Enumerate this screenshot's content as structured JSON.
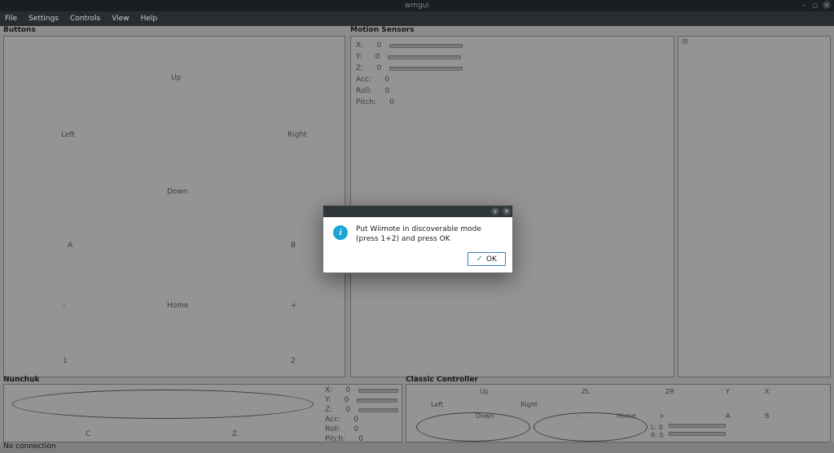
{
  "window": {
    "title": "wmgui",
    "controls": {
      "min": "–",
      "max": "○",
      "close": "✕"
    }
  },
  "menu": {
    "items": [
      "File",
      "Settings",
      "Controls",
      "View",
      "Help"
    ]
  },
  "sections": {
    "buttons": "Buttons",
    "motion": "Motion Sensors",
    "nunchuk": "Nunchuk",
    "classic": "Classic Controller",
    "ir": "IR"
  },
  "dpad": {
    "up": "Up",
    "down": "Down",
    "left": "Left",
    "right": "Right",
    "a": "A",
    "b": "B",
    "minus": "-",
    "home": "Home",
    "plus": "+",
    "one": "1",
    "two": "2"
  },
  "motion": {
    "rows": [
      {
        "label": "X:",
        "value": "0"
      },
      {
        "label": "Y:",
        "value": "0"
      },
      {
        "label": "Z:",
        "value": "0"
      },
      {
        "label": "Acc:",
        "value": "0"
      },
      {
        "label": "Roll:",
        "value": "0"
      },
      {
        "label": "Pitch:",
        "value": "0"
      }
    ]
  },
  "nunchuk": {
    "c": "C",
    "z": "Z",
    "rows": [
      {
        "label": "X:",
        "value": "0"
      },
      {
        "label": "Y:",
        "value": "0"
      },
      {
        "label": "Z:",
        "value": "0"
      },
      {
        "label": "Acc:",
        "value": "0"
      },
      {
        "label": "Roll:",
        "value": "0"
      },
      {
        "label": "Pitch:",
        "value": "0"
      }
    ]
  },
  "classic": {
    "labels": {
      "up": "Up",
      "down": "Down",
      "left": "Left",
      "right": "Right",
      "minus": "-",
      "home": "Home",
      "plus": "+",
      "zl": "ZL",
      "zr": "ZR",
      "x": "X",
      "y": "Y",
      "a": "A",
      "b": "B",
      "l0": "L: 0",
      "r0": "R: 0"
    }
  },
  "status": {
    "text": "No connection"
  },
  "dialog": {
    "message": "Put Wiimote in discoverable mode (press 1+2) and press OK",
    "ok": "OK",
    "info_glyph": "i"
  }
}
